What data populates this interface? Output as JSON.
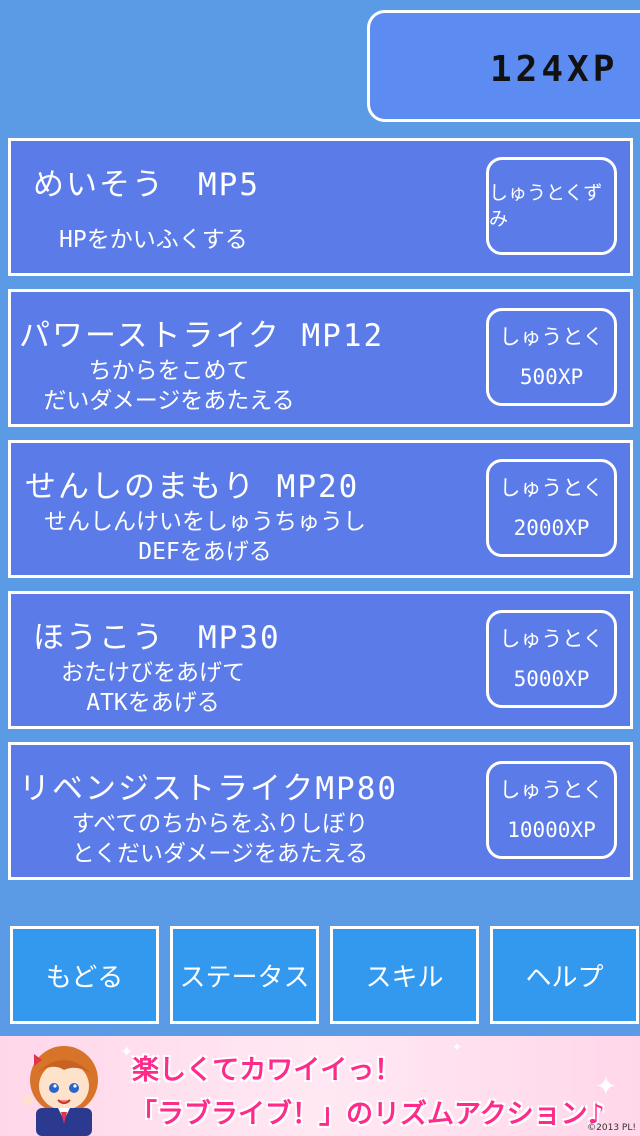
{
  "xp": {
    "value": "124XP"
  },
  "skills": [
    {
      "title": "めいそう　MP5",
      "desc": [
        "HPをかいふくする"
      ],
      "button": [
        "しゅうとくずみ"
      ],
      "learned": true
    },
    {
      "title": "パワーストライク MP12",
      "desc": [
        "ちからをこめて",
        "だいダメージをあたえる"
      ],
      "button": [
        "しゅうとく",
        "500XP"
      ],
      "learned": false
    },
    {
      "title": "せんしのまもり MP20",
      "desc": [
        "せんしんけいをしゅうちゅうし",
        "DEFをあげる"
      ],
      "button": [
        "しゅうとく",
        "2000XP"
      ],
      "learned": false
    },
    {
      "title": "ほうこう　MP30",
      "desc": [
        "おたけびをあげて",
        "ATKをあげる"
      ],
      "button": [
        "しゅうとく",
        "5000XP"
      ],
      "learned": false
    },
    {
      "title": "リベンジストライクMP80",
      "desc": [
        "すべてのちからをふりしぼり",
        "とくだいダメージをあたえる"
      ],
      "button": [
        "しゅうとく",
        "10000XP"
      ],
      "learned": false
    }
  ],
  "nav": {
    "back": "もどる",
    "status": "ステータス",
    "skill": "スキル",
    "help": "ヘルプ"
  },
  "ad": {
    "line1": "楽しくてカワイイっ！",
    "line2": "「ラブライブ！」のリズムアクション♪",
    "copyright": "©2013 PL!"
  }
}
